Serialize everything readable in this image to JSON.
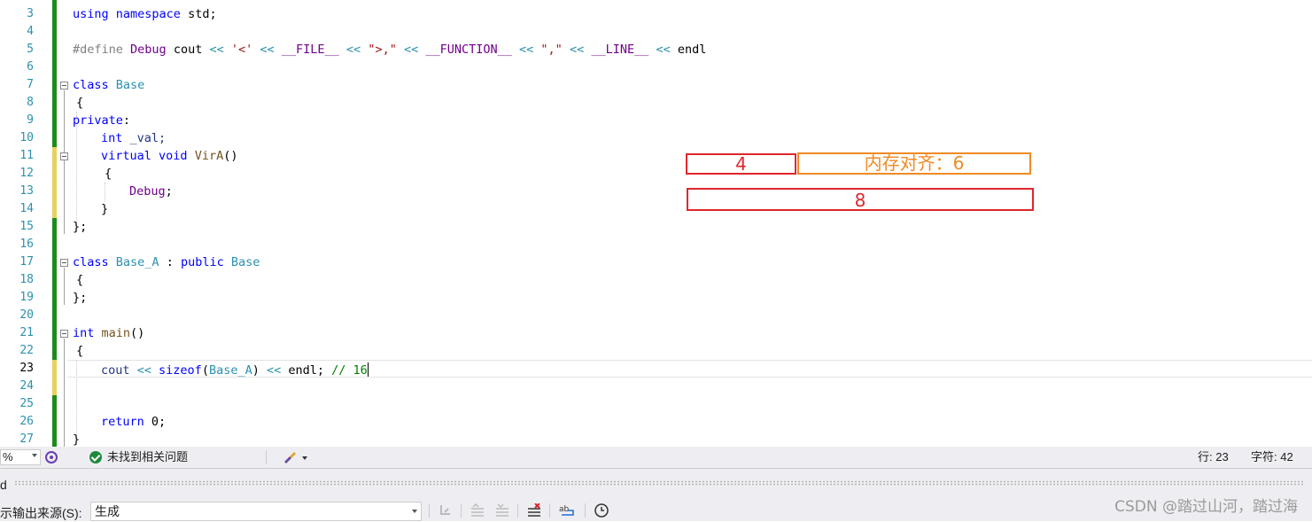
{
  "editor": {
    "current_line": "23",
    "lines": [
      {
        "num": "3"
      },
      {
        "num": "4"
      },
      {
        "num": "5"
      },
      {
        "num": "6"
      },
      {
        "num": "7"
      },
      {
        "num": "8"
      },
      {
        "num": "9"
      },
      {
        "num": "10"
      },
      {
        "num": "11"
      },
      {
        "num": "12"
      },
      {
        "num": "13"
      },
      {
        "num": "14"
      },
      {
        "num": "15"
      },
      {
        "num": "16"
      },
      {
        "num": "17"
      },
      {
        "num": "18"
      },
      {
        "num": "19"
      },
      {
        "num": "20"
      },
      {
        "num": "21"
      },
      {
        "num": "22"
      },
      {
        "num": "23"
      },
      {
        "num": "24"
      },
      {
        "num": "25"
      },
      {
        "num": "26"
      },
      {
        "num": "27"
      }
    ],
    "code": {
      "l3": {
        "kw1": "using",
        "kw2": "namespace",
        "rest": " std;"
      },
      "l5": {
        "pp": "#define",
        "name": "Debug",
        "body1": " cout ",
        "op1": "<<",
        "s1": " '<' ",
        "op2": "<<",
        "m1": " __FILE__ ",
        "op3": "<<",
        "s2": " \">,\" ",
        "op4": "<<",
        "m2": " __FUNCTION__ ",
        "op5": "<<",
        "s3": " \",\" ",
        "op6": "<<",
        "m3": " __LINE__ ",
        "op7": "<<",
        "end": " endl"
      },
      "l7": {
        "kw": "class",
        "name": " Base"
      },
      "l8": "{",
      "l9": {
        "kw": "private",
        "rest": ":"
      },
      "l10": {
        "kw": "int",
        "rest": " _val;"
      },
      "l11": {
        "kw1": "virtual",
        "kw2": "void",
        "fn": "VirA",
        "rest": "()"
      },
      "l12": "{",
      "l13": {
        "mac": "Debug",
        "rest": ";"
      },
      "l14": "}",
      "l15": "};",
      "l17": {
        "kw1": "class",
        "name1": "Base_A",
        "rest1": " : ",
        "kw2": "public",
        "name2": " Base"
      },
      "l18": "{",
      "l19": "};",
      "l21": {
        "kw": "int",
        "fn": " main",
        "rest": "()"
      },
      "l22": "{",
      "l23": {
        "a": "cout ",
        "op1": "<<",
        "kw": " sizeof",
        "p1": "(",
        "ty": "Base_A",
        "p2": ") ",
        "op2": "<<",
        "b": " endl; ",
        "cm": "// 16"
      },
      "l26": {
        "kw": "return",
        "rest": " 0;"
      },
      "l27": "}"
    }
  },
  "annotations": {
    "box_4": "4",
    "box_align": "内存对齐：6",
    "box_8": "8"
  },
  "status_bar": {
    "zoom": "%",
    "issues": "未找到相关问题",
    "row": "行: 23",
    "col": "字符: 42"
  },
  "output_panel": {
    "header_fragment": "d",
    "source_label": "示输出来源(S):",
    "source_value": "生成"
  },
  "watermark": "CSDN @踏过山河，踏过海"
}
